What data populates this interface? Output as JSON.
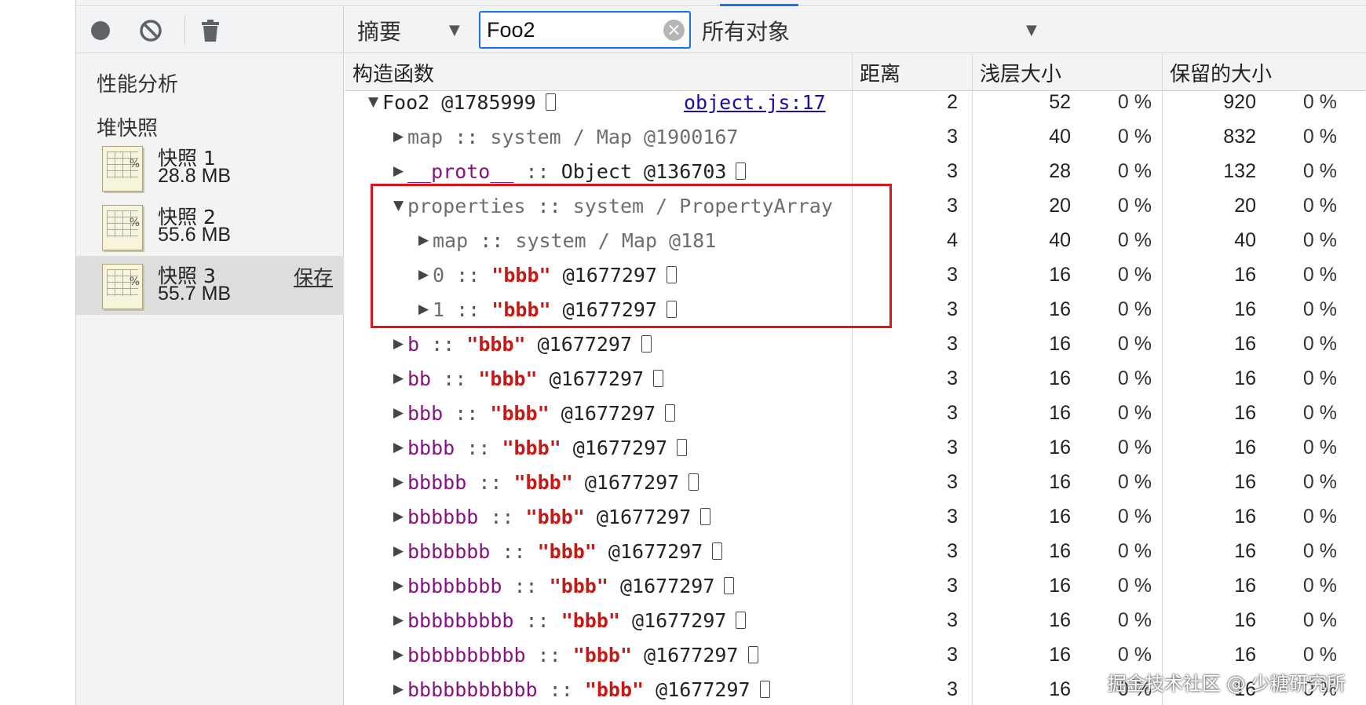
{
  "toolbar": {
    "view_select": "摘要",
    "filter_value": "Foo2",
    "objects_select": "所有对象"
  },
  "sidebar": {
    "section_title": "性能分析",
    "group_title": "堆快照",
    "snapshots": [
      {
        "name": "快照 1",
        "size": "28.8 MB"
      },
      {
        "name": "快照 2",
        "size": "55.6 MB"
      },
      {
        "name": "快照 3",
        "size": "55.7 MB",
        "action": "保存"
      }
    ]
  },
  "columns": {
    "constructor": "构造函数",
    "distance": "距离",
    "shallow": "浅层大小",
    "retained": "保留的大小"
  },
  "rows": [
    {
      "name": "Foo2",
      "sep": "",
      "detail": "@1785999",
      "link": "object.js:17",
      "distance": "2",
      "shallow": "52",
      "shallow_pct": "0 %",
      "retained": "920",
      "retained_pct": "0 %"
    },
    {
      "name": "map",
      "sep": "::",
      "detail": "system / Map @1900167",
      "distance": "3",
      "shallow": "40",
      "shallow_pct": "0 %",
      "retained": "832",
      "retained_pct": "0 %"
    },
    {
      "name": "__proto__",
      "sep": "::",
      "detail": "Object @136703",
      "distance": "3",
      "shallow": "28",
      "shallow_pct": "0 %",
      "retained": "132",
      "retained_pct": "0 %"
    },
    {
      "name": "properties",
      "sep": "::",
      "detail": "system / PropertyArray",
      "distance": "3",
      "shallow": "20",
      "shallow_pct": "0 %",
      "retained": "20",
      "retained_pct": "0 %"
    },
    {
      "name": "map",
      "sep": "::",
      "detail": "system / Map @181",
      "distance": "4",
      "shallow": "40",
      "shallow_pct": "0 %",
      "retained": "40",
      "retained_pct": "0 %"
    },
    {
      "name": "0",
      "sep": "::",
      "str": "\"bbb\"",
      "detail": "@1677297",
      "distance": "3",
      "shallow": "16",
      "shallow_pct": "0 %",
      "retained": "16",
      "retained_pct": "0 %"
    },
    {
      "name": "1",
      "sep": "::",
      "str": "\"bbb\"",
      "detail": "@1677297",
      "distance": "3",
      "shallow": "16",
      "shallow_pct": "0 %",
      "retained": "16",
      "retained_pct": "0 %"
    },
    {
      "name": "b",
      "sep": "::",
      "str": "\"bbb\"",
      "detail": "@1677297",
      "distance": "3",
      "shallow": "16",
      "shallow_pct": "0 %",
      "retained": "16",
      "retained_pct": "0 %"
    },
    {
      "name": "bb",
      "sep": "::",
      "str": "\"bbb\"",
      "detail": "@1677297",
      "distance": "3",
      "shallow": "16",
      "shallow_pct": "0 %",
      "retained": "16",
      "retained_pct": "0 %"
    },
    {
      "name": "bbb",
      "sep": "::",
      "str": "\"bbb\"",
      "detail": "@1677297",
      "distance": "3",
      "shallow": "16",
      "shallow_pct": "0 %",
      "retained": "16",
      "retained_pct": "0 %"
    },
    {
      "name": "bbbb",
      "sep": "::",
      "str": "\"bbb\"",
      "detail": "@1677297",
      "distance": "3",
      "shallow": "16",
      "shallow_pct": "0 %",
      "retained": "16",
      "retained_pct": "0 %"
    },
    {
      "name": "bbbbb",
      "sep": "::",
      "str": "\"bbb\"",
      "detail": "@1677297",
      "distance": "3",
      "shallow": "16",
      "shallow_pct": "0 %",
      "retained": "16",
      "retained_pct": "0 %"
    },
    {
      "name": "bbbbbb",
      "sep": "::",
      "str": "\"bbb\"",
      "detail": "@1677297",
      "distance": "3",
      "shallow": "16",
      "shallow_pct": "0 %",
      "retained": "16",
      "retained_pct": "0 %"
    },
    {
      "name": "bbbbbbb",
      "sep": "::",
      "str": "\"bbb\"",
      "detail": "@1677297",
      "distance": "3",
      "shallow": "16",
      "shallow_pct": "0 %",
      "retained": "16",
      "retained_pct": "0 %"
    },
    {
      "name": "bbbbbbbb",
      "sep": "::",
      "str": "\"bbb\"",
      "detail": "@1677297",
      "distance": "3",
      "shallow": "16",
      "shallow_pct": "0 %",
      "retained": "16",
      "retained_pct": "0 %"
    },
    {
      "name": "bbbbbbbbb",
      "sep": "::",
      "str": "\"bbb\"",
      "detail": "@1677297",
      "distance": "3",
      "shallow": "16",
      "shallow_pct": "0 %",
      "retained": "16",
      "retained_pct": "0 %"
    },
    {
      "name": "bbbbbbbbbb",
      "sep": "::",
      "str": "\"bbb\"",
      "detail": "@1677297",
      "distance": "3",
      "shallow": "16",
      "shallow_pct": "0 %",
      "retained": "16",
      "retained_pct": "0 %"
    },
    {
      "name": "bbbbbbbbbbb",
      "sep": "::",
      "str": "\"bbb\"",
      "detail": "@1677297",
      "distance": "3",
      "shallow": "16",
      "shallow_pct": "0 %",
      "retained": "16",
      "retained_pct": "0 %"
    }
  ],
  "watermark": "掘金技术社区 @ 少糖研究所"
}
